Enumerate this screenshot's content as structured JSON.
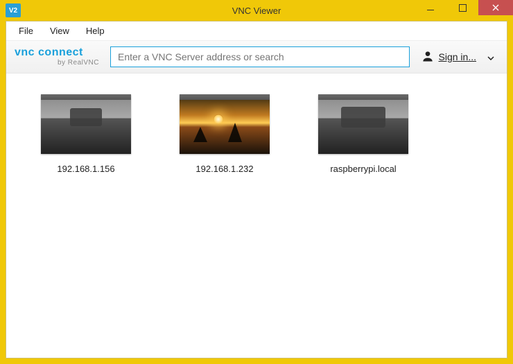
{
  "window": {
    "title": "VNC Viewer",
    "icon_text": "V2"
  },
  "menu": {
    "file": "File",
    "view": "View",
    "help": "Help"
  },
  "logo": {
    "main": "vnc connect",
    "sub": "by RealVNC"
  },
  "search": {
    "placeholder": "Enter a VNC Server address or search"
  },
  "signin": {
    "label": "Sign in..."
  },
  "connections": [
    {
      "label": "192.168.1.156",
      "style": "gray"
    },
    {
      "label": "192.168.1.232",
      "style": "sunset"
    },
    {
      "label": "raspberrypi.local",
      "style": "gray"
    }
  ]
}
